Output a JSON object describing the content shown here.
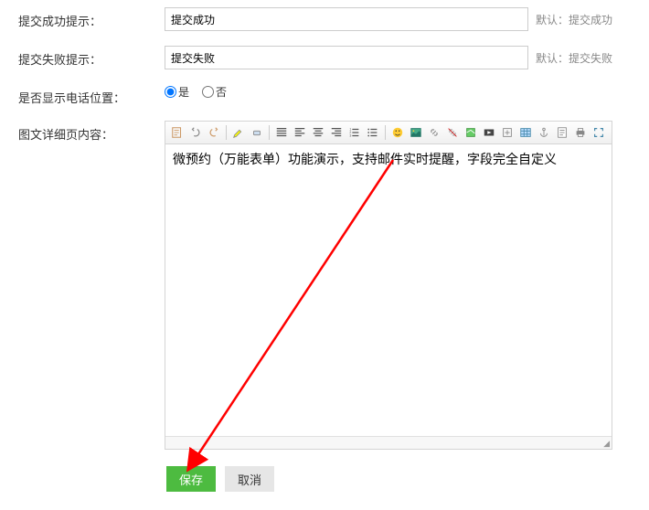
{
  "fields": {
    "success_tip": {
      "label": "提交成功提示：",
      "value": "提交成功",
      "hint": "默认：提交成功"
    },
    "fail_tip": {
      "label": "提交失败提示：",
      "value": "提交失败",
      "hint": "默认：提交失败"
    },
    "show_phone": {
      "label": "是否显示电话位置：",
      "yes": "是",
      "no": "否",
      "selected": "yes"
    },
    "detail_content": {
      "label": "图文详细页内容：",
      "value": "微预约（万能表单）功能演示，支持邮件实时提醒，字段完全自定义"
    }
  },
  "buttons": {
    "save": "保存",
    "cancel": "取消"
  },
  "colors": {
    "primary": "#4DBB40",
    "arrow": "#ff0000"
  }
}
